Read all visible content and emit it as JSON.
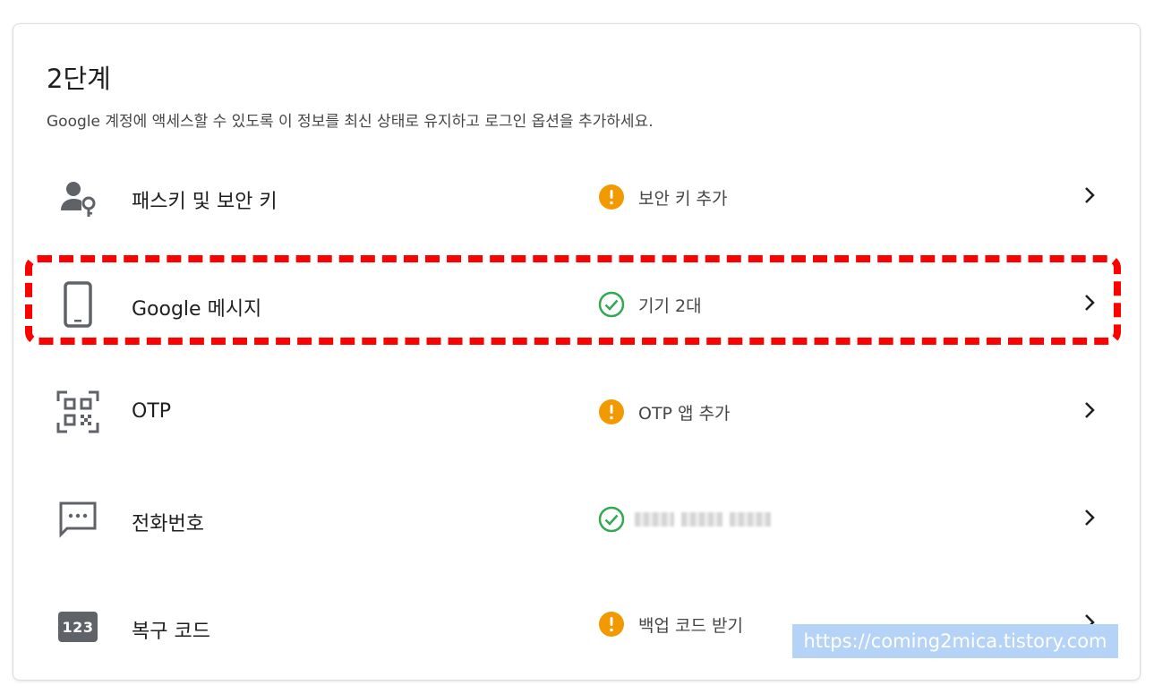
{
  "section": {
    "title": "2단계",
    "subtitle": "Google 계정에 액세스할 수 있도록 이 정보를 최신 상태로 유지하고 로그인 옵션을 추가하세요."
  },
  "rows": [
    {
      "label": "패스키 및 보안 키",
      "icon": "person-key-icon",
      "status_icon": "warning-icon",
      "status": "보안 키 추가"
    },
    {
      "label": "Google 메시지",
      "icon": "phone-icon",
      "status_icon": "check-circle-icon",
      "status": "기기 2대"
    },
    {
      "label": "OTP",
      "icon": "qr-code-icon",
      "status_icon": "warning-icon",
      "status": "OTP 앱 추가"
    },
    {
      "label": "전화번호",
      "icon": "message-icon",
      "status_icon": "check-circle-icon",
      "status": ""
    },
    {
      "label": "복구 코드",
      "icon": "number-123-icon",
      "icon_text": "123",
      "status_icon": "warning-icon",
      "status": "백업 코드 받기"
    }
  ],
  "colors": {
    "warning": "#f29900",
    "success": "#34a853",
    "icon": "#5f6368",
    "highlight": "#ff0000"
  },
  "watermark": "https://coming2mica.tistory.com"
}
